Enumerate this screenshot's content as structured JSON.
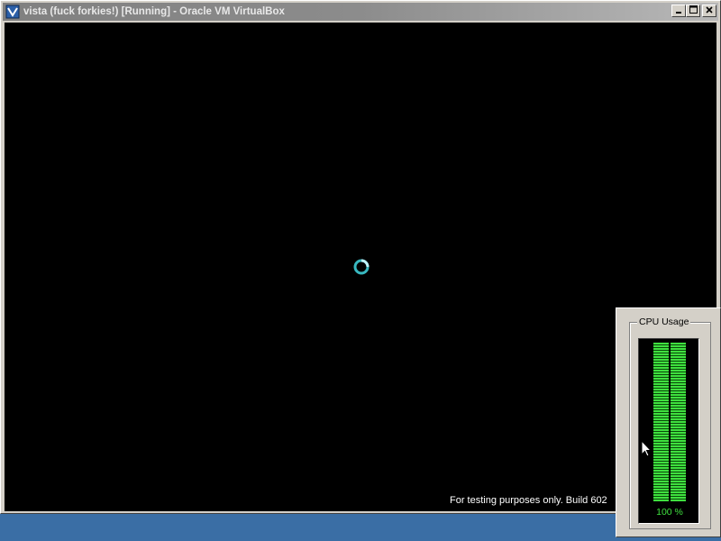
{
  "window": {
    "title": "vista (fuck forkies!) [Running] - Oracle VM VirtualBox",
    "buttons": {
      "minimize_icon": "minimize-icon",
      "maximize_icon": "maximize-icon",
      "close_icon": "close-icon"
    }
  },
  "vm_screen": {
    "background": "#000000",
    "spinner_color": "#38b8c0",
    "watermark": "For testing purposes only. Build 602"
  },
  "cpu_gadget": {
    "label": "CPU Usage",
    "usage_fraction": 1.0,
    "percent_text": "100 %",
    "meter_color": "#3fe03f"
  },
  "taskbar": {
    "color": "#3a6ea5"
  }
}
